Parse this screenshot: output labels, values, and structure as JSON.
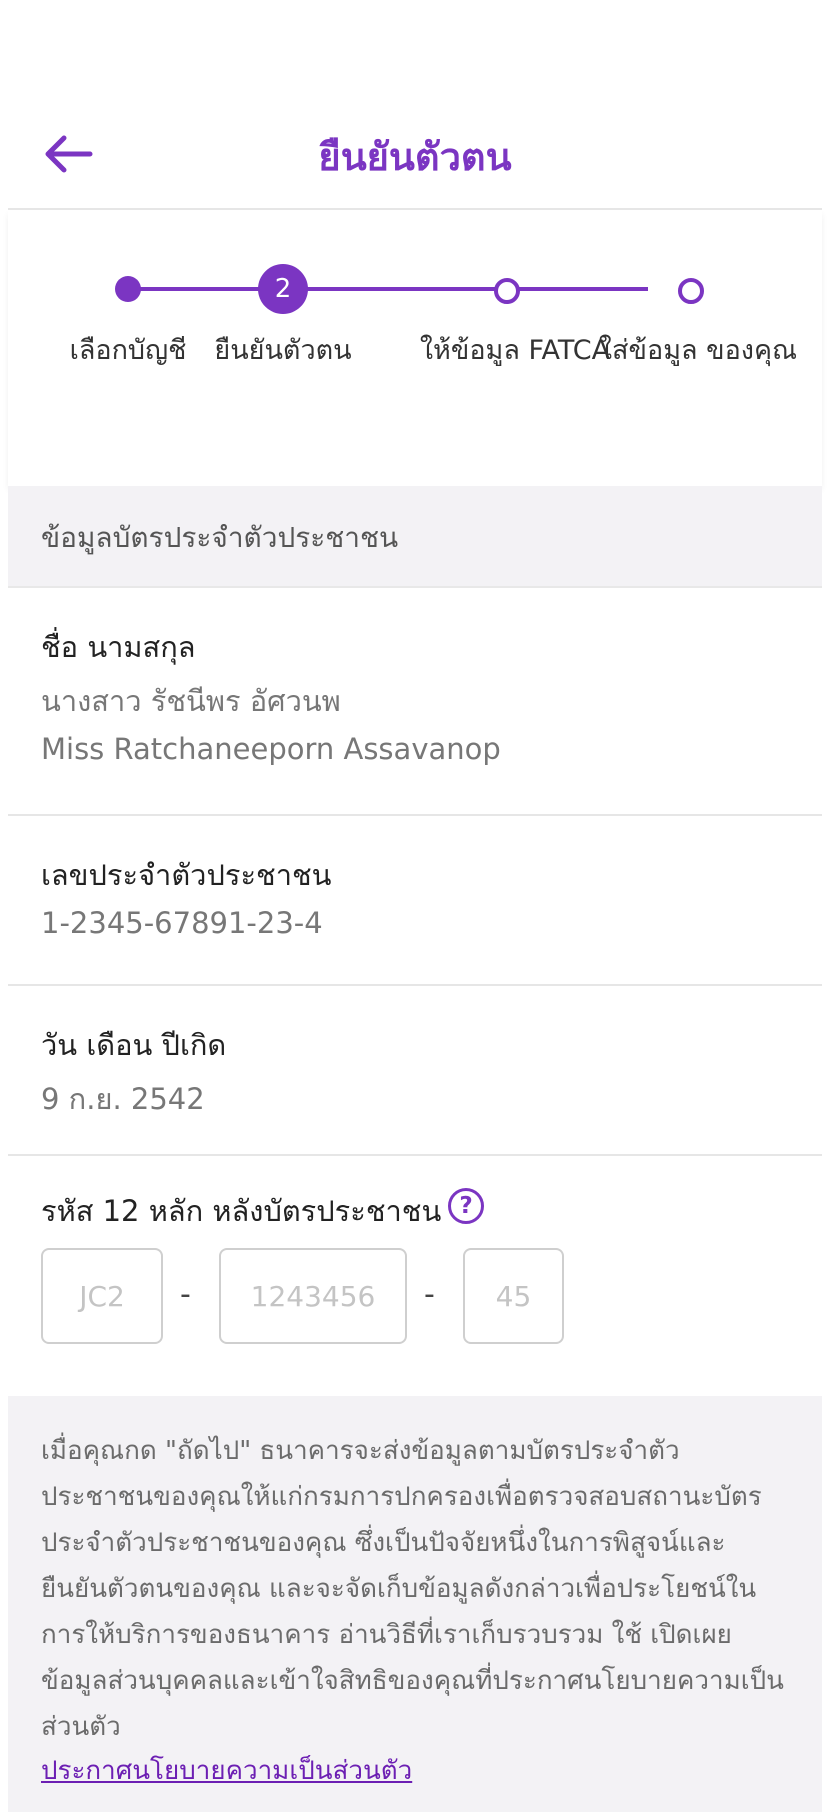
{
  "header": {
    "title": "ยืนยันตัวตน",
    "back_icon": "arrow-left-icon"
  },
  "stepper": {
    "current_step_number": "2",
    "steps": [
      {
        "label": "เลือกบัญชี",
        "state": "done"
      },
      {
        "label": "ยืนยันตัวตน",
        "state": "current"
      },
      {
        "label": "ให้ข้อมูล FATCA",
        "state": "pending"
      },
      {
        "label": "ใส่ข้อมูล ของคุณ",
        "state": "pending"
      }
    ]
  },
  "section": {
    "title": "ข้อมูลบัตรประจำตัวประชาชน"
  },
  "fields": {
    "name_label": "ชื่อ นามสกุล",
    "name_thai": "นางสาว รัชนีพร อัศวนพ",
    "name_english": "Miss Ratchaneeporn Assavanop",
    "id_label": "เลขประจำตัวประชาชน",
    "id_value": "1-2345-67891-23-4",
    "dob_label": "วัน เดือน ปีเกิด",
    "dob_value": "9 ก.ย. 2542"
  },
  "laser_code": {
    "label": "รหัส 12 หลัก หลังบัตรประชาชน",
    "help_icon": "question-circle-icon",
    "part1_placeholder": "JC2",
    "part2_placeholder": "1243456",
    "part3_placeholder": "45",
    "separator": "-"
  },
  "notice": {
    "text": "เมื่อคุณกด \"ถัดไป\" ธนาคารจะส่งข้อมูลตามบัตรประจำตัวประชาชนของคุณให้แก่กรมการปกครองเพื่อตรวจสอบสถานะบัตรประจำตัวประชาชนของคุณ ซึ่งเป็นปัจจัยหนึ่งในการพิสูจน์และยืนยันตัวตนของคุณ และจะจัดเก็บข้อมูลดังกล่าวเพื่อประโยชน์ในการให้บริการของธนาคาร อ่านวิธีที่เราเก็บรวบรวม ใช้ เปิดเผยข้อมูลส่วนบุคคลและเข้าใจสิทธิของคุณที่ประกาศนโยบายความเป็นส่วนตัว",
    "link_label": "ประกาศนโยบายความเป็นส่วนตัว"
  },
  "colors": {
    "accent": "#7b35c2",
    "link": "#6c1fb3",
    "section_bg": "#f3f2f5"
  }
}
